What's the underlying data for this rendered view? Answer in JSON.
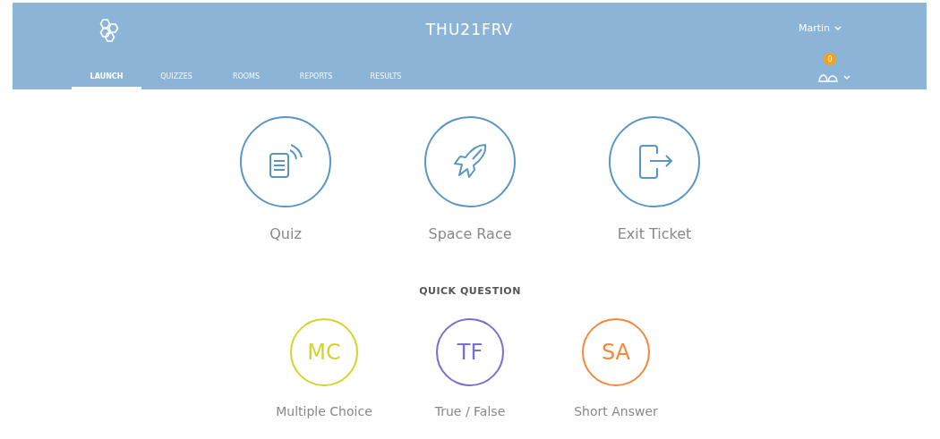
{
  "header": {
    "title": "THU21FRV",
    "user": "Martin",
    "notifications": "0"
  },
  "tabs": [
    {
      "label": "LAUNCH",
      "selected": true
    },
    {
      "label": "QUIZZES",
      "selected": false
    },
    {
      "label": "ROOMS",
      "selected": false
    },
    {
      "label": "REPORTS",
      "selected": false
    },
    {
      "label": "RESULTS",
      "selected": false
    }
  ],
  "activities": [
    {
      "kind": "quiz",
      "label": "Quiz"
    },
    {
      "kind": "race",
      "label": "Space Race"
    },
    {
      "kind": "exit",
      "label": "Exit Ticket"
    }
  ],
  "quick_question": {
    "heading": "QUICK QUESTION",
    "items": [
      {
        "abbr": "MC",
        "label": "Multiple Choice",
        "color": "#d4d42a"
      },
      {
        "abbr": "TF",
        "label": "True / False",
        "color": "#7a6fd0"
      },
      {
        "abbr": "SA",
        "label": "Short Answer",
        "color": "#f5883a"
      }
    ]
  }
}
